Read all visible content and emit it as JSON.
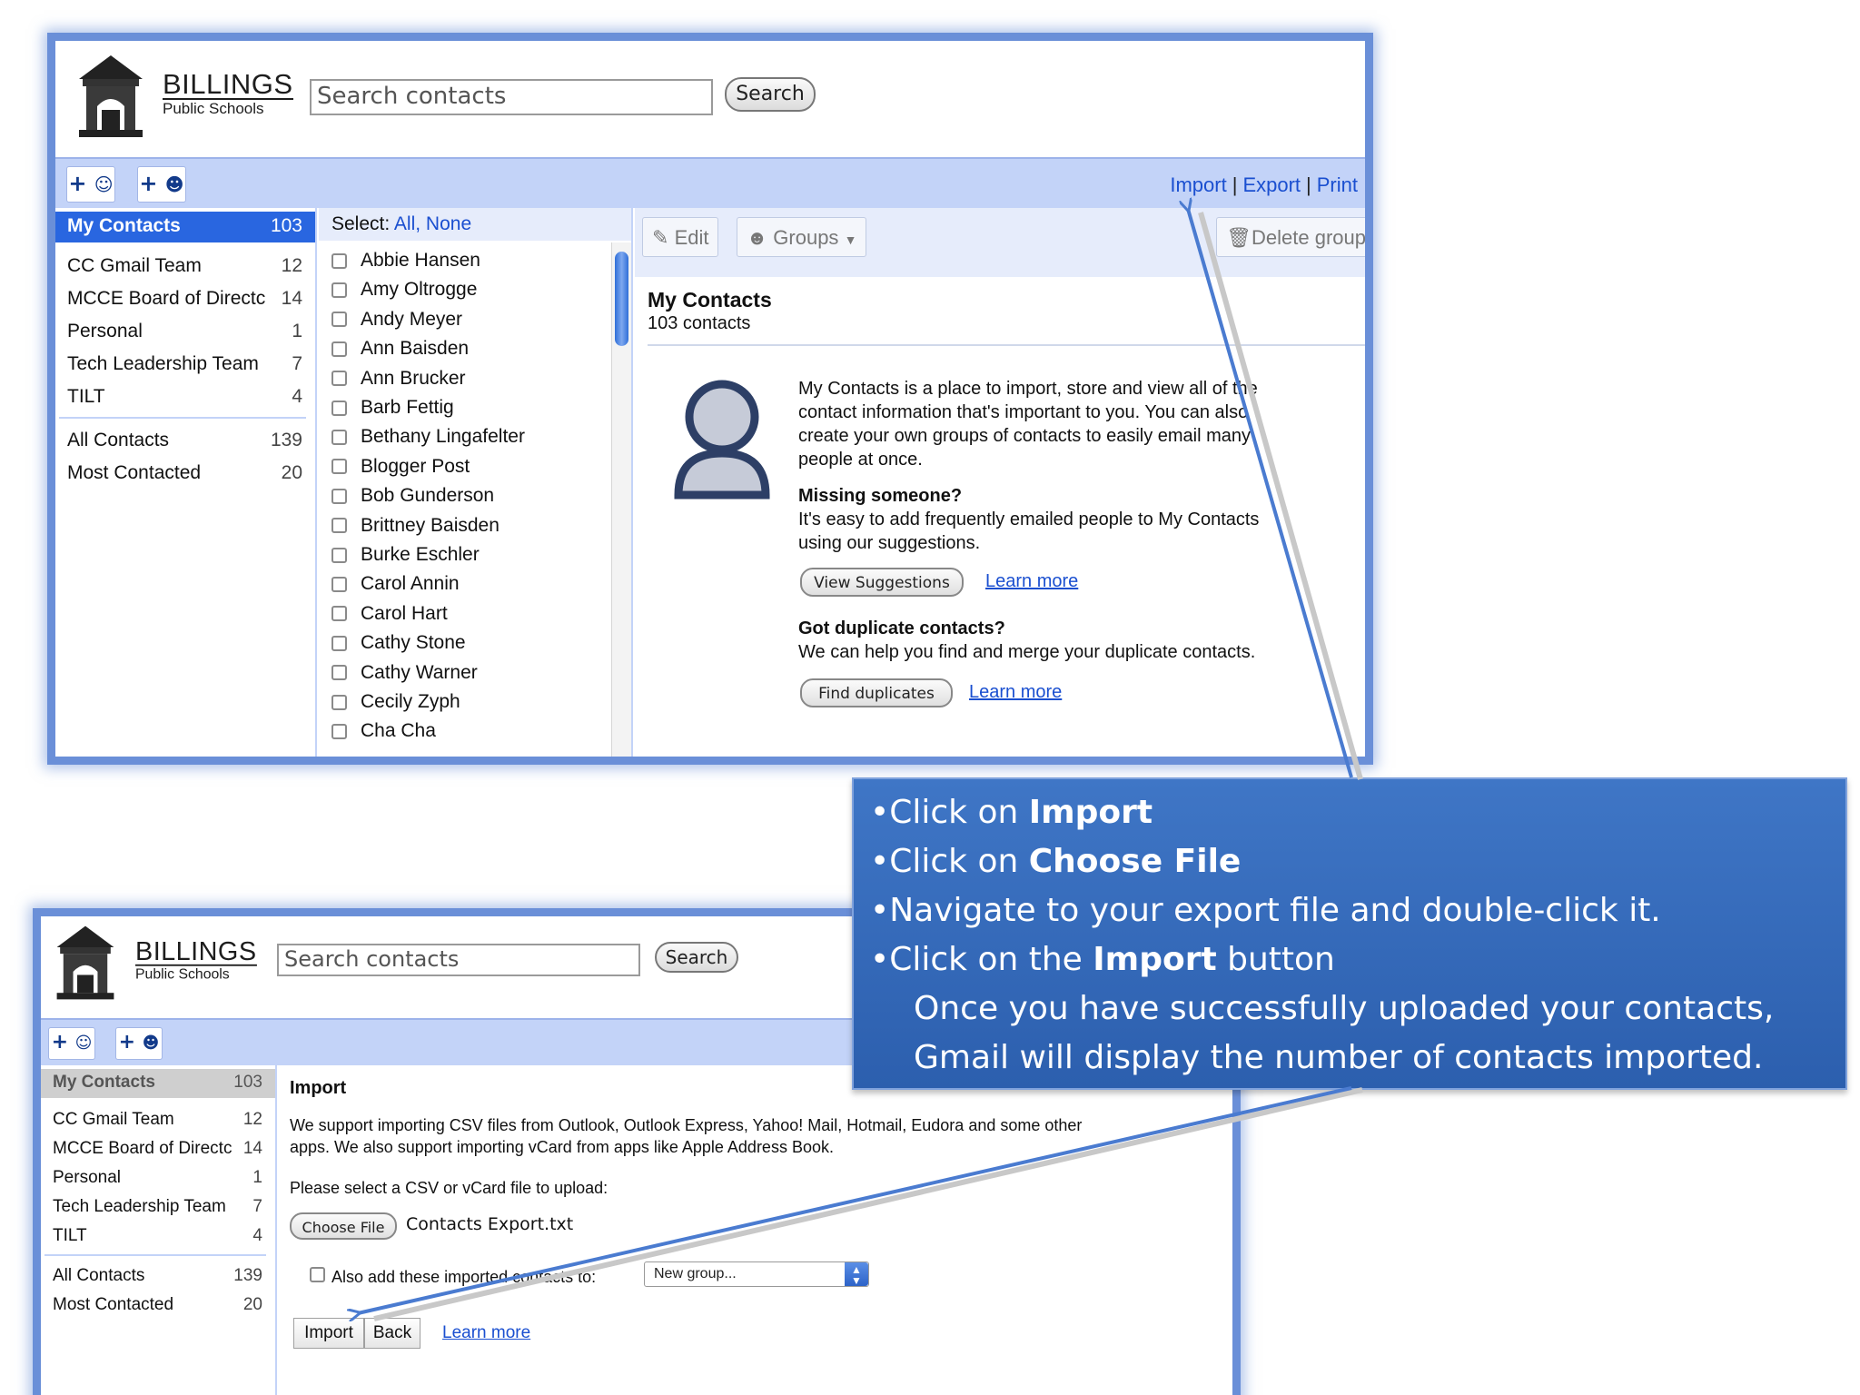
{
  "brand": {
    "name": "BILLINGS",
    "sub": "Public Schools"
  },
  "search": {
    "placeholder": "Search contacts",
    "button_label": "Search"
  },
  "top_links": {
    "import": "Import",
    "export": "Export",
    "print": "Print",
    "sep": "|"
  },
  "add_buttons": [
    "+",
    "+"
  ],
  "sidebar": {
    "my_contacts": {
      "label": "My Contacts",
      "count": "103"
    },
    "groups": [
      {
        "label": "CC Gmail Team",
        "count": "12"
      },
      {
        "label": "MCCE Board of Directc",
        "count": "14"
      },
      {
        "label": "Personal",
        "count": "1"
      },
      {
        "label": "Tech Leadership Team",
        "count": "7"
      },
      {
        "label": "TILT",
        "count": "4"
      }
    ],
    "system": [
      {
        "label": "All Contacts",
        "count": "139"
      },
      {
        "label": "Most Contacted",
        "count": "20"
      }
    ]
  },
  "list": {
    "select_label": "Select:",
    "select_all": "All,",
    "select_none": "None",
    "contacts": [
      "Abbie Hansen",
      "Amy Oltrogge",
      "Andy Meyer",
      "Ann Baisden",
      "Ann Brucker",
      "Barb Fettig",
      "Bethany Lingafelter",
      "Blogger Post",
      "Bob Gunderson",
      "Brittney Baisden",
      "Burke Eschler",
      "Carol Annin",
      "Carol Hart",
      "Cathy Stone",
      "Cathy Warner",
      "Cecily Zyph",
      "Cha Cha"
    ]
  },
  "detail": {
    "edit": "Edit",
    "groups": "Groups",
    "delete_group": "Delete group",
    "title": "My Contacts",
    "subtitle": "103 contacts",
    "intro": [
      "My Contacts is a place to import, store and view all of the",
      "contact information that's important to you. You can also",
      "create your own groups of contacts to easily email many",
      "people at once."
    ],
    "missing_title": "Missing someone?",
    "missing_text": [
      "It's easy to add frequently emailed people to My Contacts",
      "using our suggestions."
    ],
    "view_suggestions": "View Suggestions",
    "learn_more": "Learn more",
    "dup_title": "Got duplicate contacts?",
    "dup_text": "We can help you find and merge your duplicate contacts.",
    "find_duplicates": "Find duplicates"
  },
  "callout": {
    "bullet": "•",
    "l1_pre": "Click on ",
    "l1_bold": "Import",
    "l2_pre": "Click on ",
    "l2_bold": "Choose File",
    "l3": "Navigate to your export file and double-click it.",
    "l4_pre": "Click on the ",
    "l4_bold": "Import",
    "l4_post": " button",
    "l5": "Once you have successfully uploaded your contacts,",
    "l6": "Gmail will display the number of contacts imported."
  },
  "import_page": {
    "title": "Import",
    "desc": [
      "We support importing CSV files from Outlook, Outlook Express, Yahoo! Mail, Hotmail, Eudora and some other",
      "apps. We also support importing vCard from apps like Apple Address Book."
    ],
    "select_prompt": "Please select a CSV or vCard file to upload:",
    "choose_file": "Choose File",
    "file_name": "Contacts Export.txt",
    "also_add": "Also add these imported contacts to:",
    "new_group": "New group...",
    "import_btn": "Import",
    "back_btn": "Back",
    "learn_more": "Learn more"
  },
  "colors": {
    "accent": "#2966e0",
    "toolbar": "#c3d3f8",
    "callout": "#3366b8",
    "link": "#1a4fd0"
  }
}
